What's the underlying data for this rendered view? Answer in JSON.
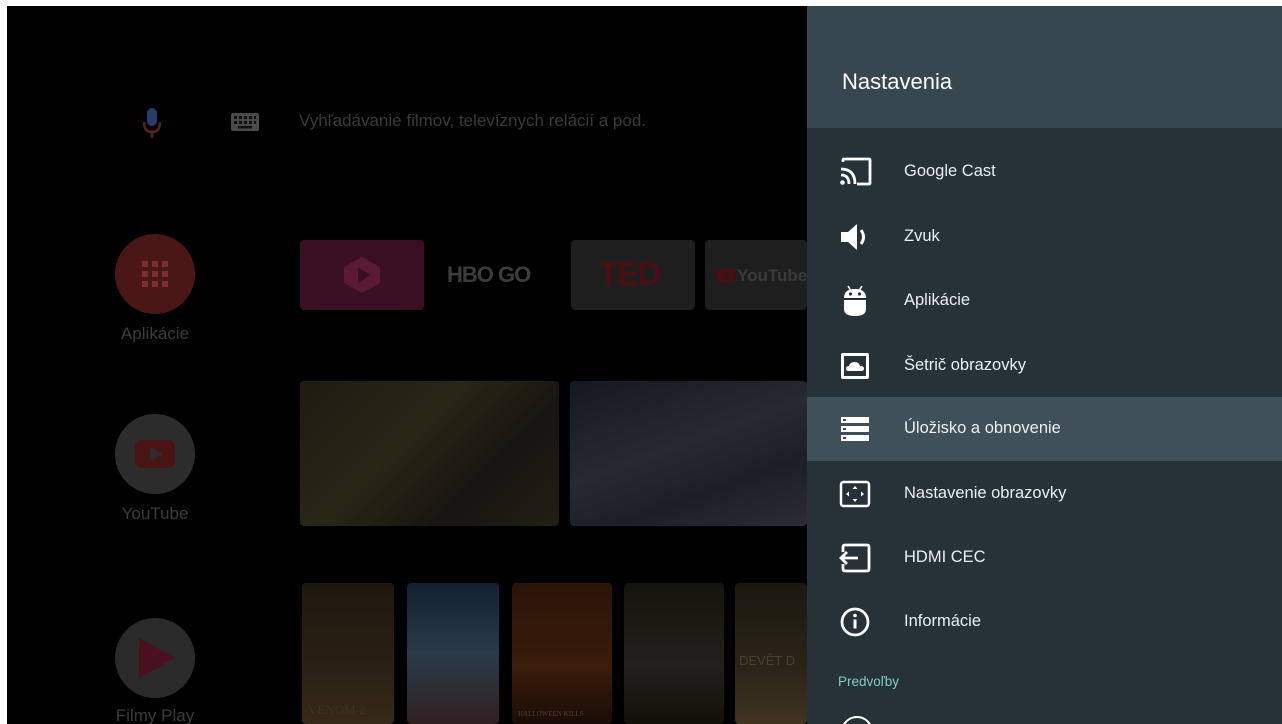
{
  "launcher": {
    "search_placeholder": "Vyhľadávanie filmov, televíznych relácií a pod.",
    "apps": [
      {
        "label": "Aplikácie"
      },
      {
        "label": "YouTube"
      },
      {
        "label": "Filmy Play"
      }
    ],
    "channel_tiles": [
      "HBO GO",
      "TED",
      "YouTube"
    ],
    "poster_texts": [
      "VENOM 2",
      "HALLOWEEN KILLS",
      "DEVĚT D"
    ]
  },
  "settings": {
    "title": "Nastavenia",
    "items": [
      {
        "label": "Google Cast",
        "icon": "cast-icon"
      },
      {
        "label": "Zvuk",
        "icon": "speaker-icon"
      },
      {
        "label": "Aplikácie",
        "icon": "android-icon"
      },
      {
        "label": "Šetrič obrazovky",
        "icon": "screensaver-icon"
      },
      {
        "label": "Úložisko a obnovenie",
        "icon": "storage-icon",
        "selected": true
      },
      {
        "label": "Nastavenie obrazovky",
        "icon": "display-icon"
      },
      {
        "label": "HDMI CEC",
        "icon": "hdmi-input-icon"
      },
      {
        "label": "Informácie",
        "icon": "info-icon"
      }
    ],
    "section_label": "Predvoľby"
  },
  "colors": {
    "panel_bg": "#263238",
    "panel_header_bg": "#37474f",
    "selected_row_bg": "#3f5059",
    "section_accent": "#80cbc4"
  }
}
